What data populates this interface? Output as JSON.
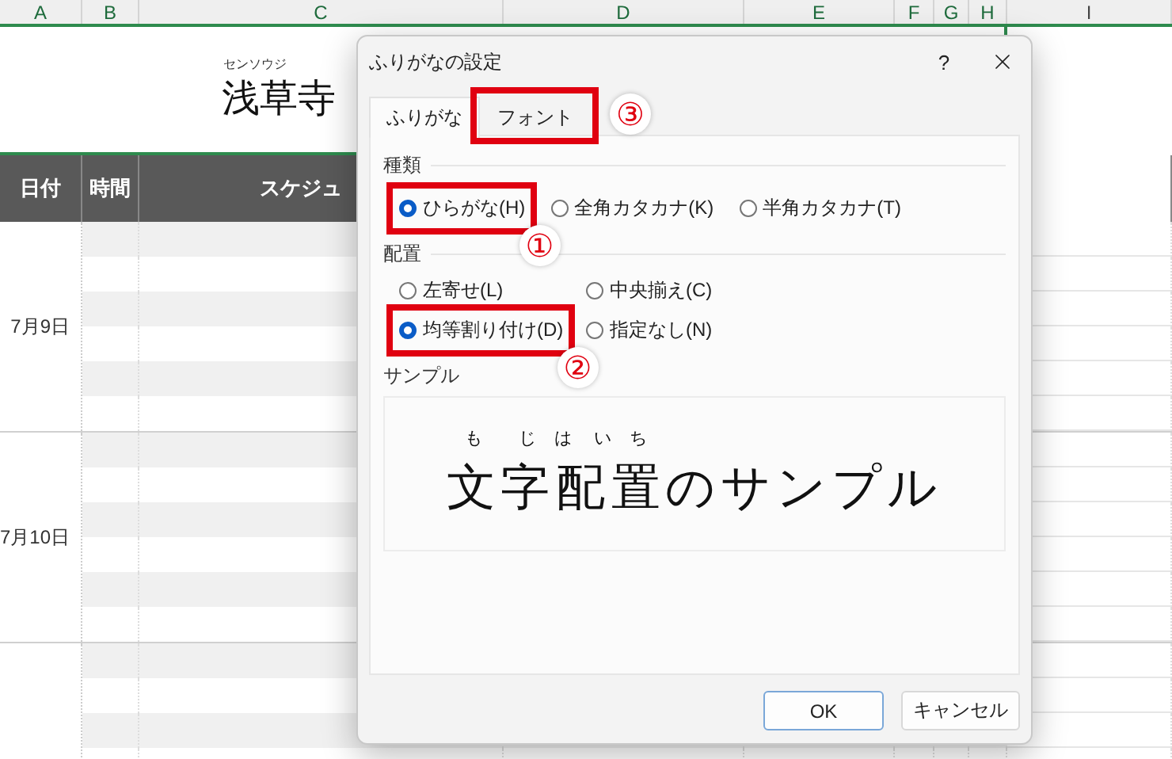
{
  "columns": [
    {
      "label": "A",
      "selected": true
    },
    {
      "label": "B",
      "selected": true
    },
    {
      "label": "C",
      "selected": true
    },
    {
      "label": "D",
      "selected": true
    },
    {
      "label": "E",
      "selected": true
    },
    {
      "label": "F",
      "selected": true
    },
    {
      "label": "G",
      "selected": true
    },
    {
      "label": "H",
      "selected": true
    },
    {
      "label": "I",
      "selected": false
    }
  ],
  "title": {
    "ruby": "センソウジ",
    "text": "浅草寺"
  },
  "header_row": [
    "日付",
    "時間",
    "スケジュ"
  ],
  "date_groups": [
    {
      "date": "7月9日"
    },
    {
      "date": "7月10日"
    }
  ],
  "dialog": {
    "title": "ふりがなの設定",
    "help": "?",
    "tabs": [
      {
        "label": "ふりがな",
        "selected": true
      },
      {
        "label": "フォント",
        "selected": false,
        "annotation": "③"
      }
    ],
    "type_section": {
      "label": "種類",
      "options": [
        {
          "label": "ひらがな(H)",
          "selected": true,
          "annotation": "①"
        },
        {
          "label": "全角カタカナ(K)",
          "selected": false
        },
        {
          "label": "半角カタカナ(T)",
          "selected": false
        }
      ]
    },
    "align_section": {
      "label": "配置",
      "options": [
        {
          "label": "左寄せ(L)",
          "selected": false
        },
        {
          "label": "中央揃え(C)",
          "selected": false
        },
        {
          "label": "均等割り付け(D)",
          "selected": true,
          "annotation": "②"
        },
        {
          "label": "指定なし(N)",
          "selected": false
        }
      ]
    },
    "sample": {
      "label": "サンプル",
      "segments": [
        {
          "text": "文",
          "ruby": "も"
        },
        {
          "text": "字",
          "ruby": "じ"
        },
        {
          "text": "配",
          "ruby": "はい"
        },
        {
          "text": "置",
          "ruby": "ち"
        },
        {
          "text": "のサンプル"
        }
      ]
    },
    "buttons": [
      {
        "label": "OK",
        "default": true
      },
      {
        "label": "キャンセル",
        "default": false
      }
    ]
  }
}
